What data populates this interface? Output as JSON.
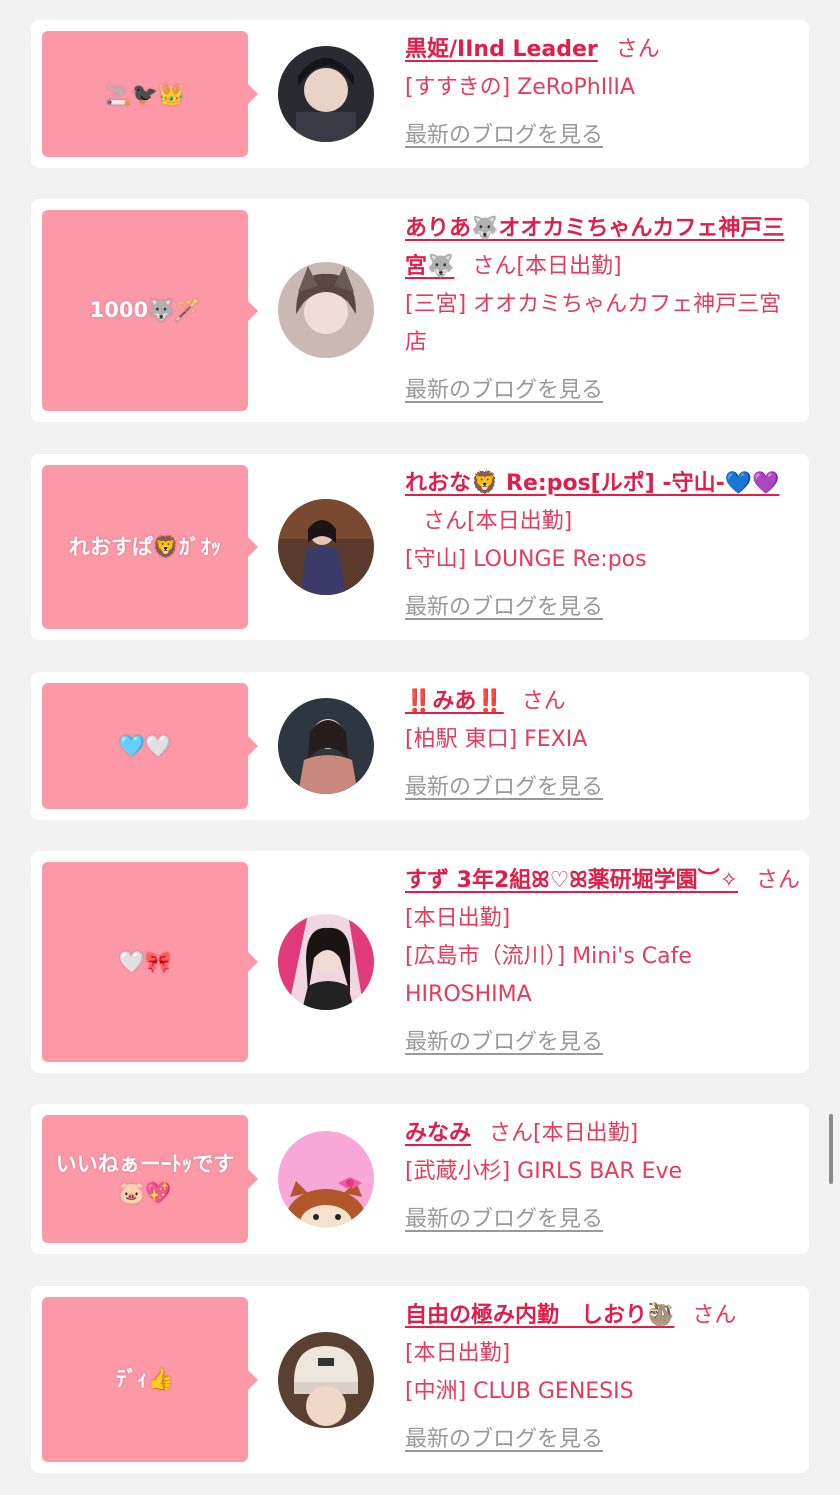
{
  "colors": {
    "bubble": "#fd98a6",
    "name": "#e01e4a",
    "text": "#e83a5a",
    "blog_link": "#999999",
    "background": "#f2f2f2"
  },
  "blog_link_label": "最新のブログを見る",
  "honorific": "さん",
  "cards": [
    {
      "bubble": "🚬🐦‍⬛👑",
      "name": "黒姫/IInd Leader",
      "status": "",
      "shop": "[すすきの] ZeRoPhIlIA",
      "avatar_icon": "avatar-photo-icon"
    },
    {
      "bubble": "1000🐺🪄",
      "name": "ありあ🐺オオカミちゃんカフェ神戸三宮🐺",
      "status": "[本日出勤]",
      "shop": "[三宮] オオカミちゃんカフェ神戸三宮店",
      "avatar_icon": "avatar-photo-icon"
    },
    {
      "bubble": "れおすぱ🦁ｶﾞｵｯ",
      "name": "れおな🦁 Re:pos[ルポ] -守山-💙💜",
      "status": "[本日出勤]",
      "shop": "[守山] LOUNGE Re:pos",
      "avatar_icon": "avatar-photo-icon"
    },
    {
      "bubble": "🩵🤍",
      "name": "‼️みあ‼️",
      "status": "",
      "shop": "[柏駅 東口] FEXIA",
      "avatar_icon": "avatar-photo-icon"
    },
    {
      "bubble": "🤍🎀",
      "name": "すず 3年2組ꕤ♡ꕤ薬研堀学園︶✧",
      "status": "[本日出勤]",
      "shop": "[広島市（流川）] Mini's Cafe HIROSHIMA",
      "avatar_icon": "avatar-photo-icon"
    },
    {
      "bubble": "いいねぁーｰﾄｯです🐷💖",
      "name": "みなみ",
      "status": "[本日出勤]",
      "shop": "[武蔵小杉] GIRLS BAR Eve",
      "avatar_icon": "avatar-kitty-icon"
    },
    {
      "bubble": "ﾃﾞｨ👍",
      "name": "自由の極み内勤　しおり🦥",
      "status": "[本日出勤]",
      "shop": "[中洲] CLUB GENESIS",
      "avatar_icon": "avatar-photo-icon"
    }
  ]
}
